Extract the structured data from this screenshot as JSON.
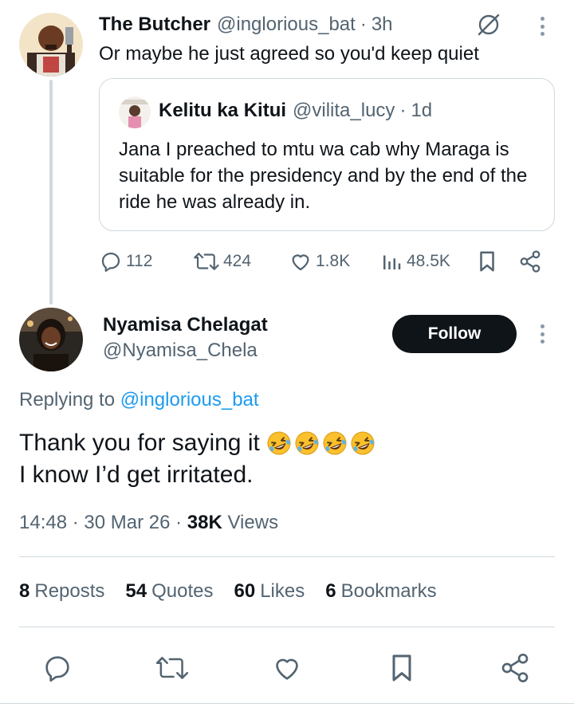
{
  "parent_tweet": {
    "name": "The Butcher",
    "handle": "@inglorious_bat",
    "time": "3h",
    "text": "Or maybe he just agreed so you'd keep quiet",
    "quote": {
      "name": "Kelitu ka Kitui",
      "handle": "@vilita_lucy",
      "time": "1d",
      "text": "Jana I preached to mtu wa cab why Maraga is suitable for the presidency and by the end of the ride he was already in."
    },
    "actions": {
      "replies": "112",
      "reposts": "424",
      "likes": "1.8K",
      "views": "48.5K"
    }
  },
  "main_tweet": {
    "name": "Nyamisa Chelagat",
    "handle": "@Nyamisa_Chela",
    "follow_label": "Follow",
    "replying_prefix": "Replying to",
    "replying_handle": "@inglorious_bat",
    "line1": "Thank you for saying it",
    "line2": "I know I’d get irritated.",
    "emoji_count": 4,
    "timestamp": "14:48 · 30 Mar 26 · ",
    "views_count": "38K",
    "views_label": "Views"
  },
  "stats": [
    {
      "num": "8",
      "label": "Reposts"
    },
    {
      "num": "54",
      "label": "Quotes"
    },
    {
      "num": "60",
      "label": "Likes"
    },
    {
      "num": "6",
      "label": "Bookmarks"
    }
  ],
  "icons": {
    "reply": "reply-icon",
    "repost": "repost-icon",
    "like": "heart-icon",
    "views": "views-icon",
    "bookmark": "bookmark-icon",
    "share": "share-icon",
    "grok": "grok-icon",
    "emoji": "rolling-laughing-emoji"
  },
  "colors": {
    "text": "#0f1419",
    "secondary": "#536471",
    "link": "#1d9bf0",
    "border": "#cfd9de",
    "follow_bg": "#0f1419",
    "emoji_yellow": "#fbc02d"
  }
}
